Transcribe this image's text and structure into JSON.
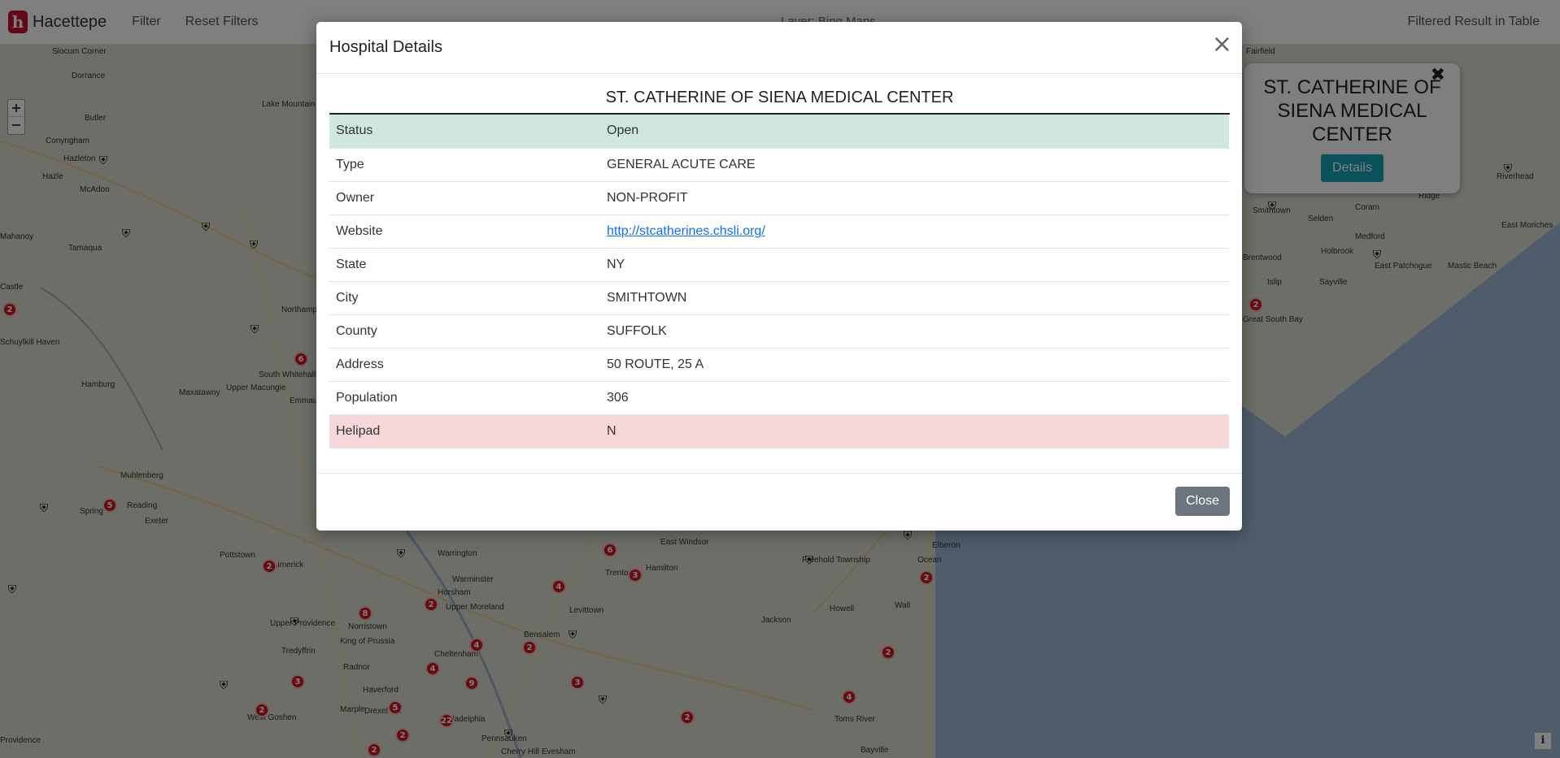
{
  "navbar": {
    "brand": "Hacettepe",
    "logo_letter": "h",
    "filter": "Filter",
    "reset": "Reset Filters",
    "center_title": "Layer: Bing Maps",
    "right_link": "Filtered Result in Table"
  },
  "map": {
    "zoom_in": "+",
    "zoom_out": "−",
    "info": "i",
    "labels": [
      "Slocum Corner",
      "Dorrance",
      "Butler",
      "Lake Mountain",
      "Conyngham",
      "Hazleton",
      "McAdoo",
      "Hazle",
      "Tamaqua",
      "Mahanoy",
      "Castle",
      "Schuylkill Haven",
      "Northampton",
      "South Whitehall",
      "Hamburg",
      "Upper Macungie",
      "Maxatawny",
      "Emmaus",
      "Muhlenberg",
      "Reading",
      "Spring",
      "Exeter",
      "Pottstown",
      "Limerick",
      "Warrington",
      "Warminster",
      "Horsham",
      "Upper Moreland",
      "Upper Providence",
      "Norristown",
      "Tredyffrin",
      "King of Prussia",
      "Radnor",
      "Haverford",
      "Marple",
      "Drexel Hill",
      "Philadelphia",
      "Pennsauken",
      "Cherry Hill",
      "Evesham",
      "West Goshen",
      "Providence",
      "East Windsor",
      "Trenton",
      "Hamilton",
      "Levittown",
      "Bensalem",
      "Cheltenham",
      "Jackson",
      "Howell",
      "Freehold Township",
      "Elberon",
      "Ocean",
      "Wall",
      "Toms River",
      "Bayville",
      "Fairfield",
      "Smithtown",
      "Selden",
      "Coram",
      "Medford",
      "Ridge",
      "Riverhead",
      "East Moriches",
      "Brentwood",
      "Islip",
      "Holbrook",
      "East Patchogue",
      "Mastic Beach",
      "Sayville",
      "Great South Bay"
    ],
    "clusters": [
      "2",
      "6",
      "5",
      "2",
      "8",
      "2",
      "4",
      "4",
      "9",
      "3",
      "22",
      "5",
      "2",
      "2",
      "3",
      "2",
      "2",
      "6",
      "3",
      "4",
      "2",
      "4",
      "2",
      "2",
      "2"
    ],
    "popup": {
      "close": "✖",
      "title": "ST. CATHERINE OF SIENA MEDICAL CENTER",
      "details_button": "Details"
    }
  },
  "modal": {
    "title": "Hospital Details",
    "close_x": "×",
    "hospital_name": "ST. CATHERINE OF SIENA MEDICAL CENTER",
    "rows": [
      {
        "label": "Status",
        "value": "Open"
      },
      {
        "label": "Type",
        "value": "GENERAL ACUTE CARE"
      },
      {
        "label": "Owner",
        "value": "NON-PROFIT"
      },
      {
        "label": "Website",
        "value": "http://stcatherines.chsli.org/"
      },
      {
        "label": "State",
        "value": "NY"
      },
      {
        "label": "City",
        "value": "SMITHTOWN"
      },
      {
        "label": "County",
        "value": "SUFFOLK"
      },
      {
        "label": "Address",
        "value": "50 ROUTE, 25 A"
      },
      {
        "label": "Population",
        "value": "306"
      },
      {
        "label": "Helipad",
        "value": "N"
      }
    ],
    "close_button": "Close"
  },
  "colors": {
    "status_open_bg": "#d1e7dd",
    "helipad_no_bg": "#f8d7da",
    "details_button": "#17a2b8",
    "close_button": "#6c757d",
    "cluster": "#c9181e"
  }
}
